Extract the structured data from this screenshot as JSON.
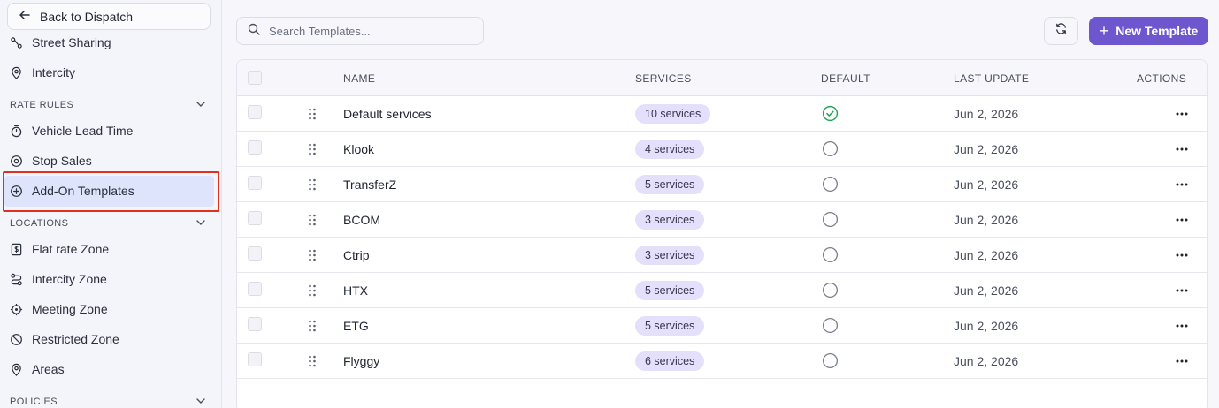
{
  "sidebar": {
    "back_label": "Back to Dispatch",
    "items_top": [
      {
        "label": "Street Sharing",
        "icon": "share-route-icon"
      },
      {
        "label": "Intercity",
        "icon": "map-pin-icon"
      }
    ],
    "rate_rules": {
      "heading": "RATE RULES",
      "items": [
        {
          "label": "Vehicle Lead Time",
          "icon": "stopwatch-icon"
        },
        {
          "label": "Stop Sales",
          "icon": "stop-circle-icon"
        },
        {
          "label": "Add-On Templates",
          "icon": "plus-circle-icon"
        }
      ]
    },
    "locations": {
      "heading": "LOCATIONS",
      "items": [
        {
          "label": "Flat rate Zone",
          "icon": "dollar-doc-icon"
        },
        {
          "label": "Intercity Zone",
          "icon": "route-icon"
        },
        {
          "label": "Meeting Zone",
          "icon": "crosshair-icon"
        },
        {
          "label": "Restricted Zone",
          "icon": "ban-icon"
        },
        {
          "label": "Areas",
          "icon": "map-pin-icon"
        }
      ]
    },
    "policies": {
      "heading": "POLICIES"
    }
  },
  "toolbar": {
    "search_placeholder": "Search Templates...",
    "new_label": "New Template"
  },
  "table": {
    "columns": {
      "name": "NAME",
      "services": "SERVICES",
      "default": "DEFAULT",
      "last_update": "LAST UPDATE",
      "actions": "ACTIONS"
    },
    "rows": [
      {
        "name": "Default services",
        "services": "10 services",
        "is_default": true,
        "last_update": "Jun 2, 2026"
      },
      {
        "name": "Klook",
        "services": "4 services",
        "is_default": false,
        "last_update": "Jun 2, 2026"
      },
      {
        "name": "TransferZ",
        "services": "5 services",
        "is_default": false,
        "last_update": "Jun 2, 2026"
      },
      {
        "name": "BCOM",
        "services": "3 services",
        "is_default": false,
        "last_update": "Jun 2, 2026"
      },
      {
        "name": "Ctrip",
        "services": "3 services",
        "is_default": false,
        "last_update": "Jun 2, 2026"
      },
      {
        "name": "HTX",
        "services": "5 services",
        "is_default": false,
        "last_update": "Jun 2, 2026"
      },
      {
        "name": "ETG",
        "services": "5 services",
        "is_default": false,
        "last_update": "Jun 2, 2026"
      },
      {
        "name": "Flyggy",
        "services": "6 services",
        "is_default": false,
        "last_update": "Jun 2, 2026"
      }
    ]
  },
  "colors": {
    "accent": "#6e56cf",
    "badge_bg": "#e4e0fb",
    "default_check": "#22a35a",
    "active_highlight": "#dde4fb",
    "annotation_box": "#e0301e"
  }
}
